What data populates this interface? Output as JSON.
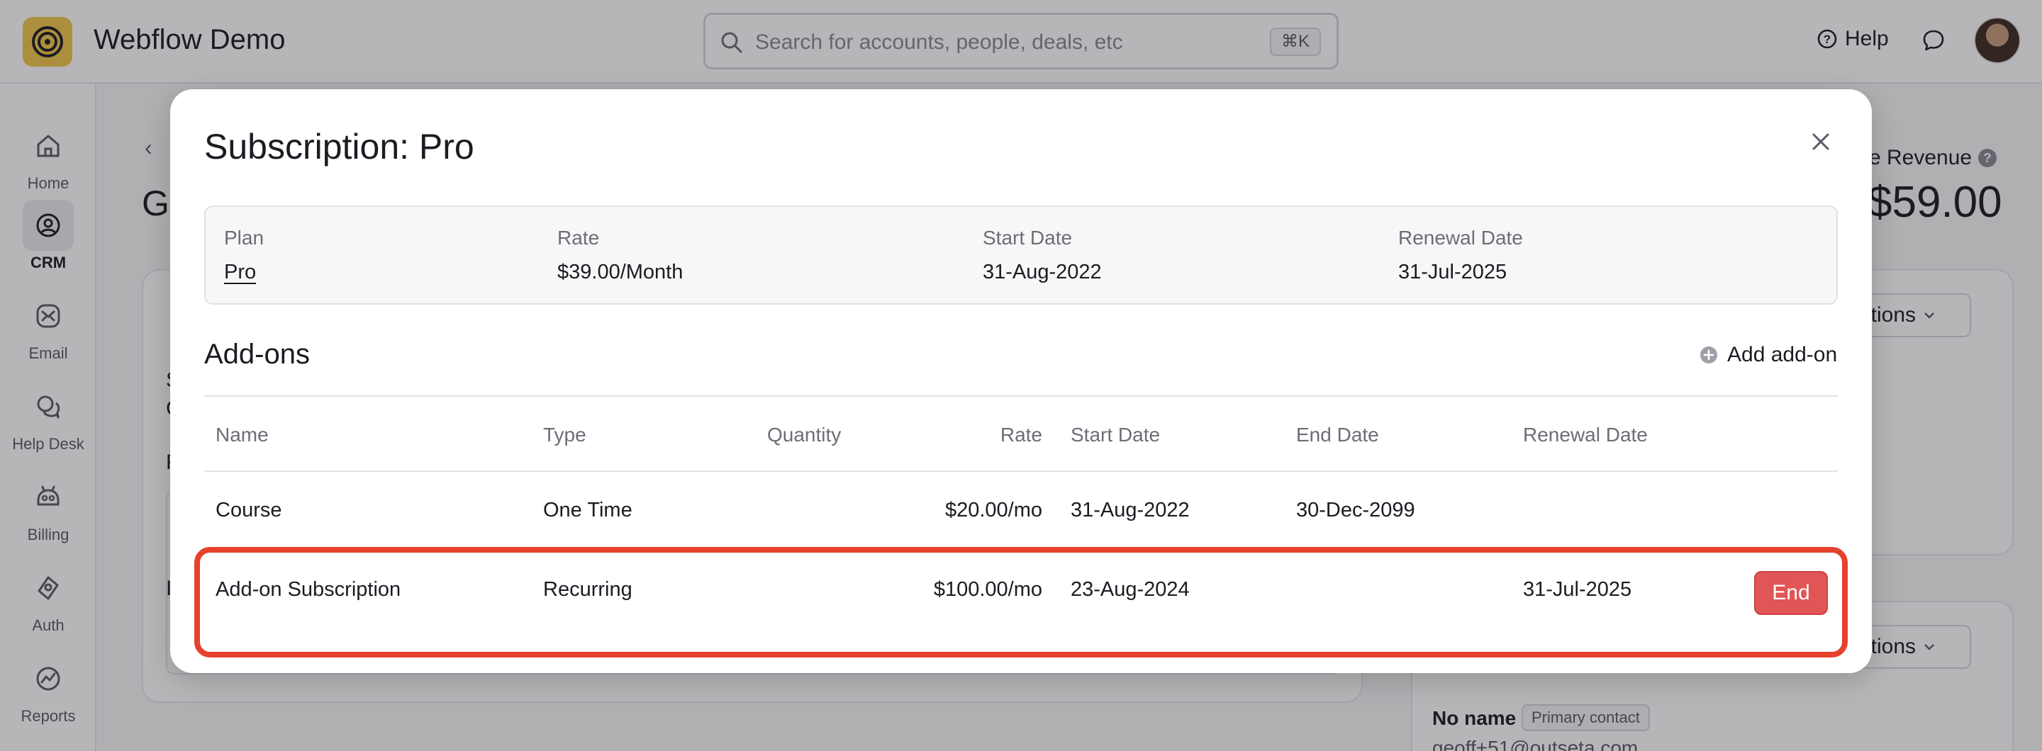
{
  "app": {
    "title": "Webflow Demo"
  },
  "search": {
    "placeholder": "Search for accounts, people, deals, etc",
    "shortcut": "⌘K"
  },
  "header": {
    "help_label": "Help"
  },
  "sidebar": {
    "items": [
      {
        "label": "Home",
        "icon": "home-icon"
      },
      {
        "label": "CRM",
        "icon": "crm-icon",
        "active": true
      },
      {
        "label": "Email",
        "icon": "email-icon"
      },
      {
        "label": "Help Desk",
        "icon": "help-desk-icon"
      },
      {
        "label": "Billing",
        "icon": "billing-icon"
      },
      {
        "label": "Auth",
        "icon": "auth-icon"
      },
      {
        "label": "Reports",
        "icon": "reports-icon"
      }
    ]
  },
  "background": {
    "heading_fragment": "G",
    "card_label_fragment": "S",
    "row_fragments": [
      "C",
      "F",
      "P",
      "I"
    ],
    "revenue_label": "e Revenue",
    "revenue_help": "?",
    "revenue_value": "$59.00",
    "options_label": "ptions",
    "contact_name": "No name",
    "contact_badge": "Primary contact",
    "contact_email": "geoff+51@outseta.com"
  },
  "modal": {
    "title": "Subscription: Pro",
    "summary": {
      "plan_label": "Plan",
      "plan_value": "Pro",
      "rate_label": "Rate",
      "rate_value": "$39.00/Month",
      "start_label": "Start Date",
      "start_value": "31-Aug-2022",
      "renewal_label": "Renewal Date",
      "renewal_value": "31-Jul-2025"
    },
    "addons_title": "Add-ons",
    "add_addon_label": "Add add-on",
    "columns": [
      "Name",
      "Type",
      "Quantity",
      "Rate",
      "Start Date",
      "End Date",
      "Renewal Date"
    ],
    "rows": [
      {
        "name": "Course",
        "type": "One Time",
        "quantity": "",
        "rate": "$20.00/mo",
        "start": "31-Aug-2022",
        "end": "30-Dec-2099",
        "renewal": ""
      },
      {
        "name": "Add-on Subscription",
        "type": "Recurring",
        "quantity": "",
        "rate": "$100.00/mo",
        "start": "23-Aug-2024",
        "end": "",
        "renewal": "31-Jul-2025",
        "action": "End"
      }
    ]
  },
  "colors": {
    "accent_logo": "#f0c64c",
    "highlight": "#e5412d",
    "end_button": "#e05555"
  }
}
